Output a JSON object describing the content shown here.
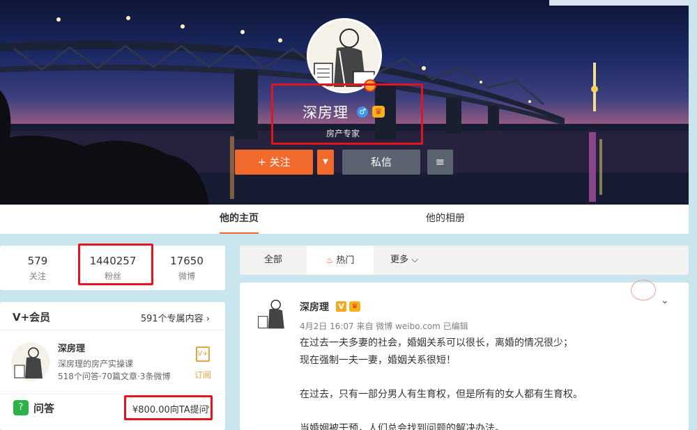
{
  "profile": {
    "name": "深房理",
    "title": "房产专家",
    "follow_label": "+ 关注",
    "follow_more": "▼",
    "message_label": "私信",
    "menu_icon": "≡",
    "gender_icon": "male-icon",
    "vip_icon": "crown-icon"
  },
  "profile_tabs": [
    {
      "label": "他的主页",
      "active": true
    },
    {
      "label": "他的相册",
      "active": false
    }
  ],
  "stats": [
    {
      "value": "579",
      "label": "关注"
    },
    {
      "value": "1440257",
      "label": "粉丝"
    },
    {
      "value": "17650",
      "label": "微博"
    }
  ],
  "vip_card": {
    "title": "V+会员",
    "more": "591个专属内容 ›",
    "name": "深房理",
    "desc": "深房理的房产实操课",
    "counts": "518个问答·70篇文章·3条微博",
    "subscribe_icon": "V+",
    "subscribe_label": "订阅",
    "qa_icon": "?",
    "qa_label": "问答",
    "qa_price": "¥800.00向TA提问",
    "qa_chevron": "›"
  },
  "feed_tabs": [
    {
      "label": "全部",
      "active": false
    },
    {
      "label": "热门",
      "active": true,
      "icon": "flame-icon"
    },
    {
      "label": "更多",
      "active": false,
      "icon": "chevron-down-icon"
    }
  ],
  "feed_tab_icons": {
    "flame": "♨",
    "chevron": "⌵"
  },
  "post": {
    "author": "深房理",
    "badge": "V",
    "crown": "♛",
    "meta": "4月2日 16:07 来自 微博 weibo.com  已编辑",
    "chevron": "⌄",
    "lines": [
      "在过去一夫多妻的社会，婚姻关系可以很长，离婚的情况很少；",
      "现在强制一夫一妻，婚姻关系很短！",
      "",
      "在过去，只有一部分男人有生育权，但是所有的女人都有生育权。",
      "",
      "当婚姻被干预，人们总会找到问题的解决办法。"
    ]
  },
  "colors": {
    "accent": "#f26a2b",
    "highlight": "#e3141f",
    "page_bg": "#c9e6ee",
    "gray_button": "#5c6370"
  }
}
